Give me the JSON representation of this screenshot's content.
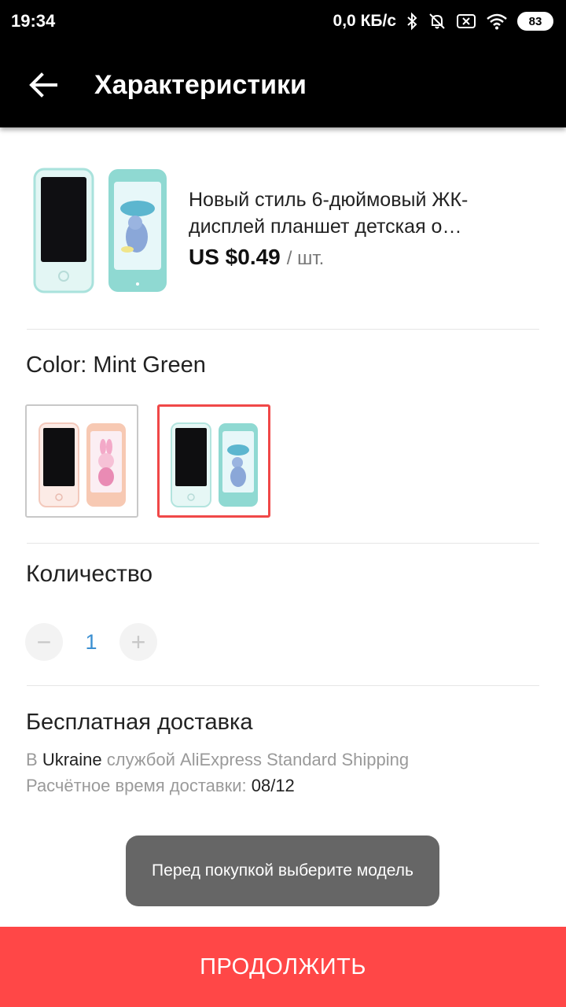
{
  "status_bar": {
    "time": "19:34",
    "speed": "0,0 КБ/с",
    "battery": "83",
    "icons": [
      "bluetooth-icon",
      "mute-icon",
      "sim-off-icon",
      "wifi-icon",
      "battery-icon"
    ]
  },
  "header": {
    "title": "Характеристики",
    "back_icon": "back-arrow-icon"
  },
  "product": {
    "title": "Новый стиль 6-дюймовый ЖК-дисплей планшет детская о…",
    "price": "US $0.49",
    "unit": "/ шт."
  },
  "color": {
    "label": "Color: Mint Green",
    "options": [
      {
        "name": "pink",
        "selected": false,
        "tint": "#f7c9b3"
      },
      {
        "name": "mint",
        "selected": true,
        "tint": "#8fd9d2"
      }
    ],
    "selected_border_color": "#f04848"
  },
  "quantity": {
    "label": "Количество",
    "value": "1",
    "minus": "−",
    "plus": "+"
  },
  "shipping": {
    "title": "Бесплатная доставка",
    "line1_prefix": "В",
    "line1_country": "Ukraine",
    "line1_suffix": "службой AliExpress Standard Shipping",
    "line2_prefix": "Расчётное время доставки:",
    "line2_date": "08/12"
  },
  "toast": {
    "text": "Перед покупкой выберите модель"
  },
  "footer": {
    "continue_label": "ПРОДОЛЖИТЬ",
    "accent_color": "#ff4747"
  }
}
